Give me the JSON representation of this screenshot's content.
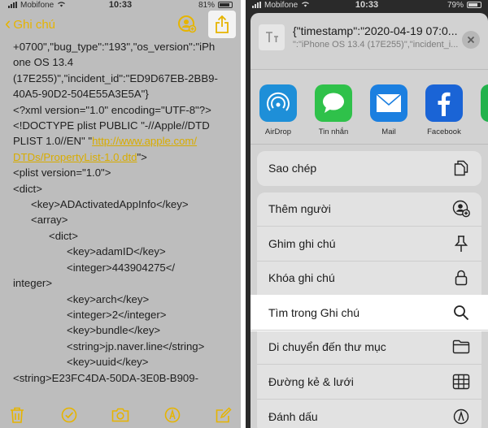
{
  "left": {
    "status": {
      "carrier": "Mobifone",
      "time": "10:33",
      "battery": "81%"
    },
    "nav": {
      "back_label": "Ghi chú"
    },
    "note_lines": [
      {
        "indent": 0,
        "text": "+0700\",\"bug_type\":\"193\",\"os_version\":\"iPh"
      },
      {
        "indent": 0,
        "text": "one OS 13.4"
      },
      {
        "indent": 0,
        "text": "(17E255)\",\"incident_id\":\"ED9D67EB-2BB9-"
      },
      {
        "indent": 0,
        "text": "40A5-90D2-504E55A3E5A\"}"
      },
      {
        "indent": 0,
        "text": "<?xml version=\"1.0\" encoding=\"UTF-8\"?>"
      },
      {
        "indent": 0,
        "text": "<!DOCTYPE plist PUBLIC \"-//Apple//DTD"
      },
      {
        "indent": 0,
        "text": "PLIST 1.0//EN\" \"",
        "link": "http://www.apple.com/"
      },
      {
        "indent": 0,
        "text": "",
        "link": "DTDs/PropertyList-1.0.dtd",
        "after": "\">"
      },
      {
        "indent": 0,
        "text": "<plist version=\"1.0\">"
      },
      {
        "indent": 0,
        "text": "<dict>"
      },
      {
        "indent": 1,
        "text": "<key>ADActivatedAppInfo</key>"
      },
      {
        "indent": 1,
        "text": "<array>"
      },
      {
        "indent": 2,
        "text": "<dict>"
      },
      {
        "indent": 3,
        "text": "<key>adamID</key>"
      },
      {
        "indent": 3,
        "text": "<integer>443904275</"
      },
      {
        "indent": 0,
        "text": "integer>"
      },
      {
        "indent": 3,
        "text": "<key>arch</key>"
      },
      {
        "indent": 3,
        "text": "<integer>2</integer>"
      },
      {
        "indent": 3,
        "text": "<key>bundle</key>"
      },
      {
        "indent": 3,
        "text": "<string>jp.naver.line</string>"
      },
      {
        "indent": 3,
        "text": "<key>uuid</key>"
      },
      {
        "indent": 0,
        "text": ""
      },
      {
        "indent": 0,
        "text": "<string>E23FC4DA-50DA-3E0B-B909-"
      }
    ],
    "toolbar": [
      {
        "name": "trash-icon"
      },
      {
        "name": "checklist-icon"
      },
      {
        "name": "camera-icon"
      },
      {
        "name": "markup-icon"
      },
      {
        "name": "compose-icon"
      }
    ],
    "accent": "#e6b400"
  },
  "right": {
    "status": {
      "carrier": "Mobifone",
      "time": "10:33",
      "battery": "79%"
    },
    "sheet": {
      "title": "{\"timestamp\":\"2020-04-19 07:0...",
      "subtitle": "\":\"iPhone OS 13.4 (17E255)\",\"incident_i..."
    },
    "apps": [
      {
        "label": "AirDrop",
        "name": "airdrop",
        "color": "#1e8fd8"
      },
      {
        "label": "Tin nhắn",
        "name": "messages",
        "color": "#2fc14a"
      },
      {
        "label": "Mail",
        "name": "mail",
        "color": "#1b7fe0"
      },
      {
        "label": "Facebook",
        "name": "facebook",
        "color": "#1a64d6"
      },
      {
        "label": "",
        "name": "partial-app",
        "color": "#22b24c"
      }
    ],
    "copy_action": {
      "label": "Sao chép",
      "icon": "copy-icon"
    },
    "actions": [
      {
        "label": "Thêm người",
        "icon": "add-person-icon",
        "key": "add-people"
      },
      {
        "label": "Ghim ghi chú",
        "icon": "pin-icon",
        "key": "pin-note"
      },
      {
        "label": "Khóa ghi chú",
        "icon": "lock-icon",
        "key": "lock-note"
      },
      {
        "label": "Tìm trong Ghi chú",
        "icon": "search-icon",
        "key": "find-in-note",
        "highlight": true
      },
      {
        "label": "Di chuyển đến thư mục",
        "icon": "folder-icon",
        "key": "move-to-folder"
      },
      {
        "label": "Đường kẻ & lưới",
        "icon": "grid-icon",
        "key": "lines-grids"
      },
      {
        "label": "Đánh dấu",
        "icon": "markup-icon",
        "key": "markup"
      }
    ]
  }
}
